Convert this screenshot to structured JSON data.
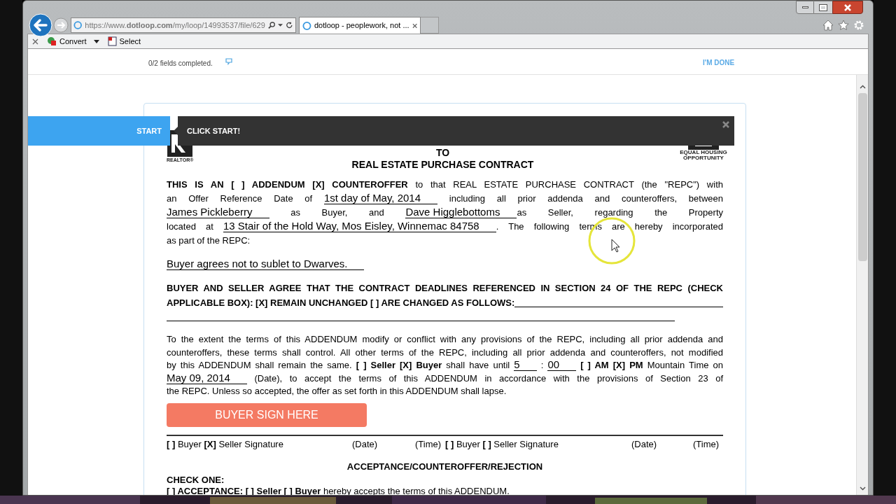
{
  "browser": {
    "address": "https://www.**dotloop.com**/my/loop/14993537/file/629",
    "tabs": [
      {
        "title": "dotloop - peoplework, not ...",
        "selected": true
      }
    ]
  },
  "command_bar": {
    "items": [
      {
        "label": "Convert",
        "dropdown": true
      },
      {
        "label": "Select",
        "dropdown": false
      }
    ]
  },
  "header": {
    "progress": "0/2 fields completed.",
    "done_button": "I'M DONE"
  },
  "guide": {
    "start_button": "START",
    "message": "CLICK START!"
  },
  "document": {
    "realtor_caption": "REALTOR®",
    "housing_caption": "EQUAL HOUSING OPPORTUNITY",
    "title_lines": [
      "TO",
      "REAL ESTATE PURCHASE CONTRACT"
    ],
    "paragraphs": [
      {
        "lines": [
          [
            {
              "kind": "bold",
              "text": "THIS IS AN [ ] ADDENDUM [X] COUNTEROFFER"
            },
            {
              "kind": "plain",
              "text": " to that REAL ESTATE PURCHASE CONTRACT (the \"REPC\") with"
            }
          ],
          [
            {
              "kind": "plain",
              "text": "an Offer Reference Date of "
            },
            {
              "kind": "fill",
              "text": "1st day of May, 2014"
            },
            {
              "kind": "plain",
              "text": " including all prior addenda and counteroffers, between"
            }
          ],
          [
            {
              "kind": "fill",
              "text": "James Pickleberry"
            },
            {
              "kind": "plain",
              "text": " as Buyer, and "
            },
            {
              "kind": "fill",
              "text": "Dave Higglebottoms"
            },
            {
              "kind": "plain",
              "text": "as Seller, regarding the Property"
            }
          ],
          [
            {
              "kind": "plain",
              "text": "located at "
            },
            {
              "kind": "fill",
              "text": "13 Stair of the Hold Way, Mos Eisley, Winnemac 84758"
            },
            {
              "kind": "plain",
              "text": ". The following terms are hereby incorporated"
            }
          ],
          [
            {
              "kind": "plain",
              "text": "as part of the REPC:"
            }
          ]
        ]
      },
      {
        "lines": [
          [
            {
              "kind": "fill",
              "text": "Buyer agrees not to sublet to Dwarves."
            }
          ]
        ]
      },
      {
        "lines": [
          [
            {
              "kind": "bold",
              "text": "BUYER AND SELLER AGREE THAT THE CONTRACT DEADLINES REFERENCED IN SECTION 24 OF THE REPC (CHECK"
            }
          ],
          [
            {
              "kind": "bold",
              "text": "APPLICABLE BOX): [X] REMAIN UNCHANGED [ ] ARE CHANGED AS FOLLOWS: "
            },
            {
              "kind": "blank"
            }
          ],
          [
            {
              "kind": "blank"
            }
          ]
        ]
      },
      {
        "lines": [
          [
            {
              "kind": "plain",
              "text": "To the extent the terms of this ADDENDUM modify or conflict with any provisions of the REPC, including all prior addenda and"
            }
          ],
          [
            {
              "kind": "plain",
              "text": "counteroffers, these terms shall control. All other terms of the REPC, including all prior addenda and counteroffers, not modified"
            }
          ],
          [
            {
              "kind": "plain",
              "text": "by this ADDENDUM shall remain the same. "
            },
            {
              "kind": "bold",
              "text": "[ ] Seller [X] Buyer"
            },
            {
              "kind": "plain",
              "text": " shall have until "
            },
            {
              "kind": "fill",
              "text": "5"
            },
            {
              "kind": "plain",
              "text": " : "
            },
            {
              "kind": "fill",
              "text": "00"
            },
            {
              "kind": "bold",
              "text": " [ ] AM [X] PM"
            },
            {
              "kind": "plain",
              "text": " Mountain Time on"
            }
          ],
          [
            {
              "kind": "fill",
              "text": "May 09, 2014"
            },
            {
              "kind": "plain",
              "text": " (Date), to accept the terms of this ADDENDUM in accordance with the provisions of Section 23 of"
            }
          ],
          [
            {
              "kind": "plain",
              "text": "the REPC. Unless so accepted, the offer as set forth in this ADDENDUM shall lapse."
            }
          ]
        ]
      }
    ],
    "sign_button": "BUYER SIGN HERE",
    "signature_labels": [
      "**[ ]** Buyer **[X]** Seller Signature",
      "(Date)",
      "(Time)",
      "**[ ]** Buyer **[ ]** Seller Signature",
      "(Date)",
      "(Time)"
    ],
    "section_title": "ACCEPTANCE/COUNTEROFFER/REJECTION",
    "check_one": "CHECK ONE:",
    "acceptance_line": "**[ ] ACCEPTANCE: [ ] Seller [ ] Buyer** hereby accepts the terms of this ADDENDUM."
  }
}
